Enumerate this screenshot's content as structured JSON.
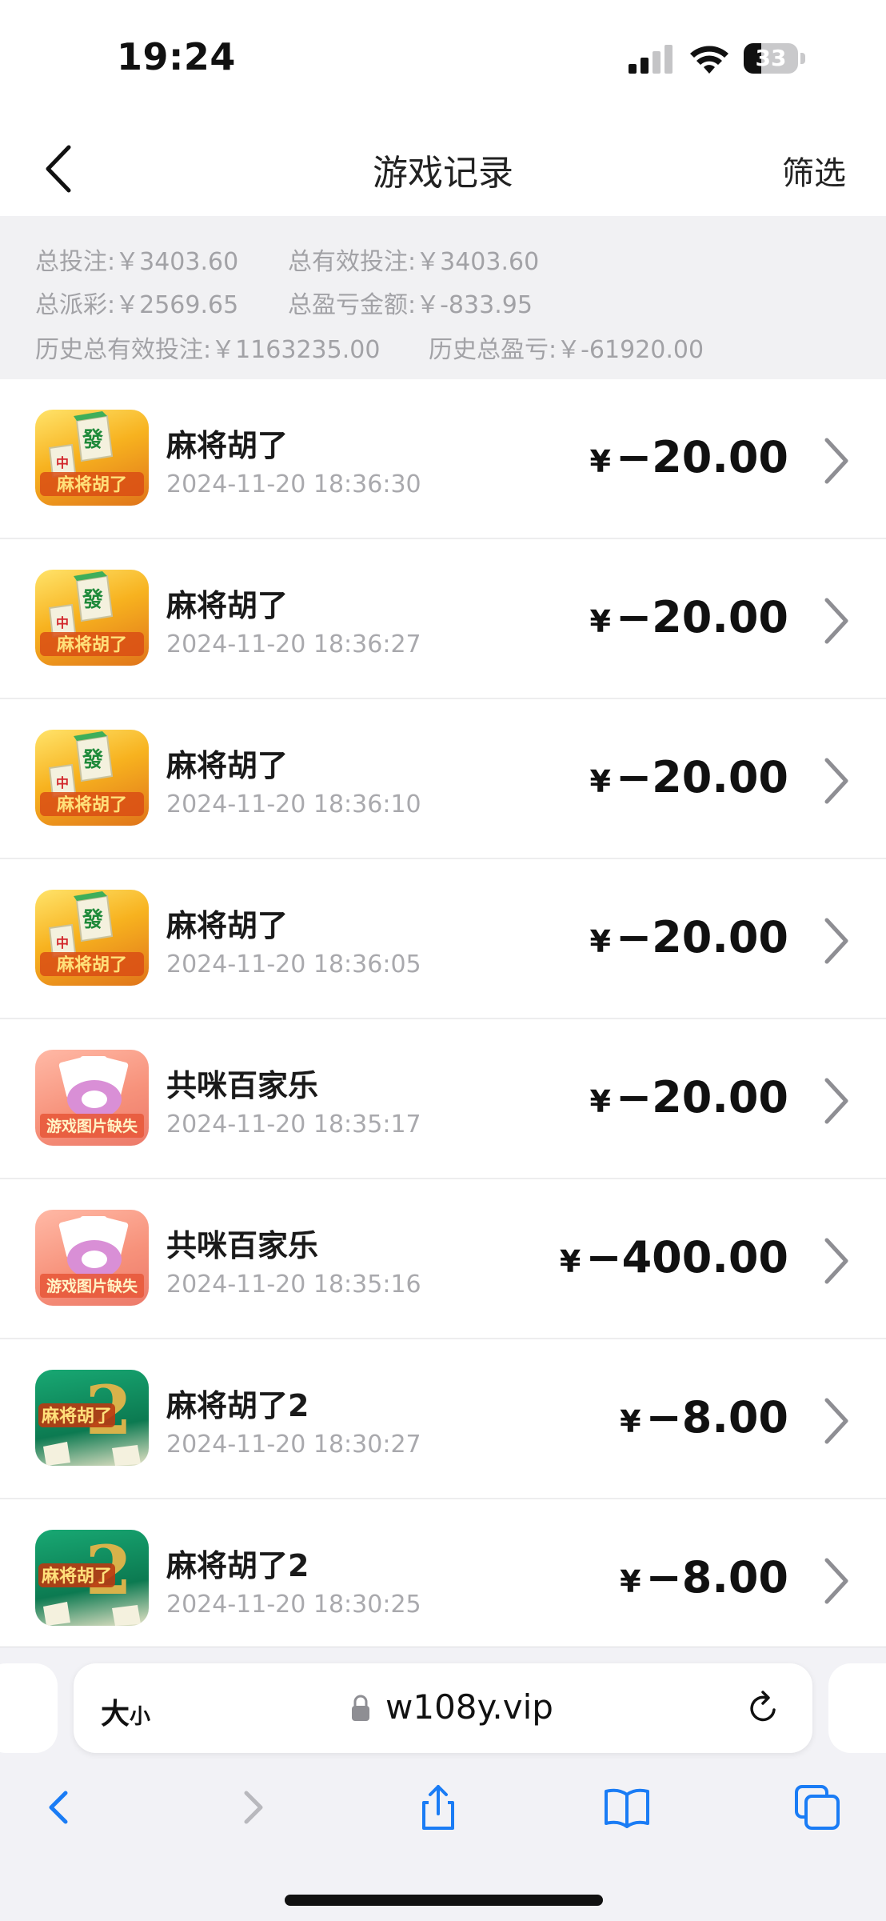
{
  "status": {
    "time": "19:24",
    "battery": "33",
    "battery_level": 0.33
  },
  "nav": {
    "title": "游戏记录",
    "filter": "筛选"
  },
  "summary": {
    "total_bet": "总投注:￥3403.60",
    "total_valid_bet": "总有效投注:￥3403.60",
    "total_payout": "总派彩:￥2569.65",
    "total_profit": "总盈亏金额:￥-833.95",
    "history_valid_bet": "历史总有效投注:￥1163235.00",
    "history_profit": "历史总盈亏:￥-61920.00"
  },
  "records": [
    {
      "name": "麻将胡了",
      "time": "2024-11-20 18:36:30",
      "currency": "¥",
      "amount": "−20.00",
      "icon": "mahjong-game-icon"
    },
    {
      "name": "麻将胡了",
      "time": "2024-11-20 18:36:27",
      "currency": "¥",
      "amount": "−20.00",
      "icon": "mahjong-game-icon"
    },
    {
      "name": "麻将胡了",
      "time": "2024-11-20 18:36:10",
      "currency": "¥",
      "amount": "−20.00",
      "icon": "mahjong-game-icon"
    },
    {
      "name": "麻将胡了",
      "time": "2024-11-20 18:36:05",
      "currency": "¥",
      "amount": "−20.00",
      "icon": "mahjong-game-icon"
    },
    {
      "name": "共咪百家乐",
      "time": "2024-11-20 18:35:17",
      "currency": "¥",
      "amount": "−20.00",
      "icon": "baccarat-game-icon",
      "icon_text": "游戏图片缺失"
    },
    {
      "name": "共咪百家乐",
      "time": "2024-11-20 18:35:16",
      "currency": "¥",
      "amount": "−400.00",
      "icon": "baccarat-game-icon",
      "icon_text": "游戏图片缺失"
    },
    {
      "name": "麻将胡了2",
      "time": "2024-11-20 18:30:27",
      "currency": "¥",
      "amount": "−8.00",
      "icon": "mahjong2-game-icon"
    },
    {
      "name": "麻将胡了2",
      "time": "2024-11-20 18:30:25",
      "currency": "¥",
      "amount": "−8.00",
      "icon": "mahjong2-game-icon"
    }
  ],
  "browser": {
    "text_size": "大",
    "text_size_small": "小",
    "url": "w108y.vip"
  },
  "icons": {
    "signal": "cellular-signal-icon",
    "wifi": "wifi-icon",
    "battery": "battery-icon",
    "back": "chevron-left-icon",
    "row_chevron": "chevron-right-icon",
    "lock": "lock-icon",
    "reload": "reload-icon",
    "browser_back": "browser-back-icon",
    "browser_forward": "browser-forward-icon",
    "share": "share-icon",
    "bookmarks": "bookmarks-icon",
    "tabs": "tabs-icon"
  },
  "colors": {
    "accent": "#1a7cf5",
    "summary_bg": "#f1f1f3",
    "summary_text": "#a2a2a6"
  }
}
